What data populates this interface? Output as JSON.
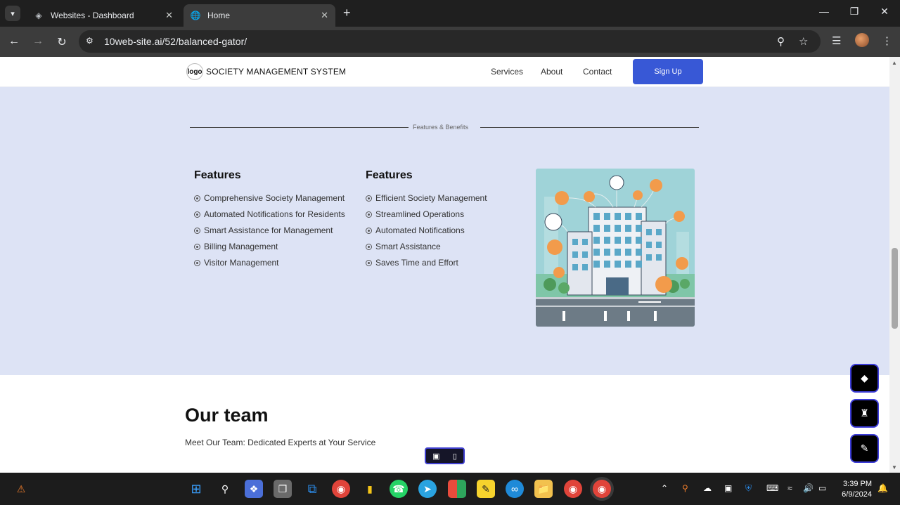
{
  "browser": {
    "tabs": [
      {
        "title": "Websites - Dashboard",
        "active": false
      },
      {
        "title": "Home",
        "active": true
      }
    ],
    "url": "10web-site.ai/52/balanced-gator/"
  },
  "site": {
    "logo_text": "logo",
    "brand": "SOCIETY MANAGEMENT SYSTEM",
    "nav": [
      "Services",
      "About",
      "Contact"
    ],
    "signup_label": "Sign Up"
  },
  "features_section": {
    "divider_label": "Features & Benefits",
    "columns": [
      {
        "heading": "Features",
        "items": [
          "Comprehensive Society Management",
          "Automated Notifications for Residents",
          "Smart Assistance for Management",
          "Billing Management",
          "Visitor Management"
        ]
      },
      {
        "heading": "Features",
        "items": [
          "Efficient Society Management",
          "Streamlined Operations",
          "Automated Notifications",
          "Smart Assistance",
          "Saves Time and Effort"
        ]
      }
    ]
  },
  "team": {
    "title": "Our team",
    "subtitle": "Meet Our Team: Dedicated Experts at Your Service"
  },
  "taskbar": {
    "time": "3:39 PM",
    "date": "6/9/2024"
  },
  "colors": {
    "accent": "#3858d6",
    "section_bg": "#dde3f5",
    "float_border": "#3c3cd8"
  }
}
